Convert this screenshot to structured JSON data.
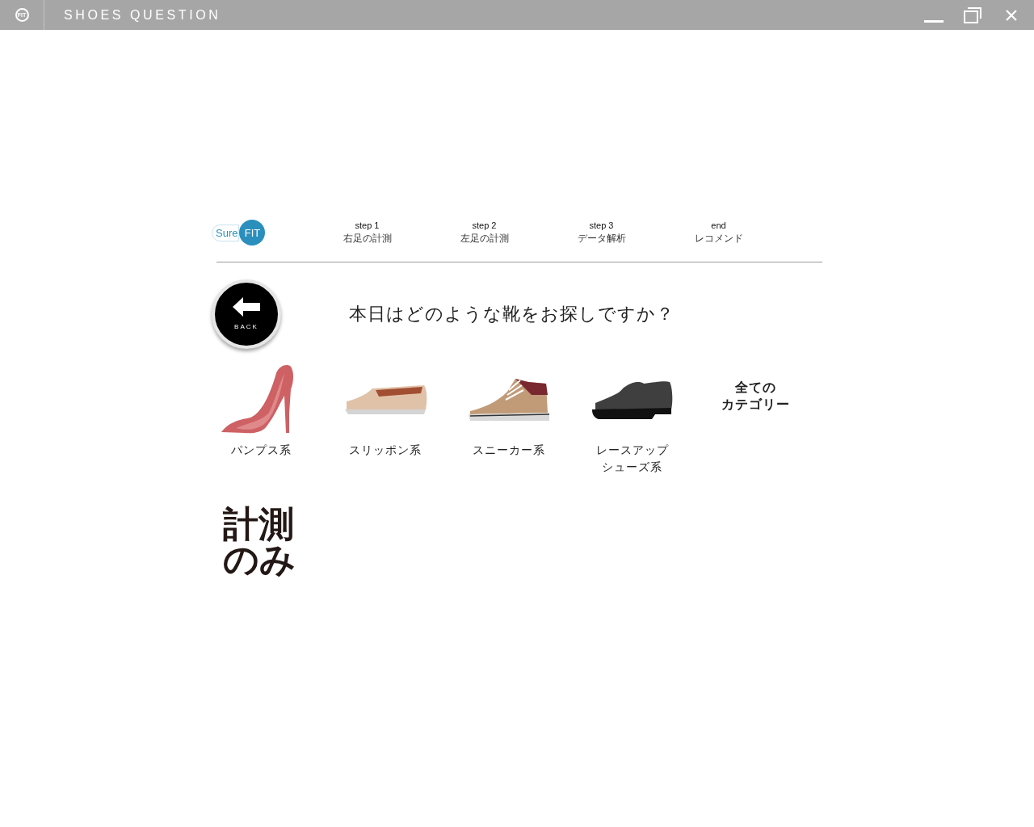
{
  "window": {
    "logo": "FIT",
    "title": "SHOES QUESTION"
  },
  "brand": {
    "part_1": "Sure",
    "part_2": "FIT"
  },
  "steps": [
    {
      "step": "step 1",
      "label": "右足の計測"
    },
    {
      "step": "step 2",
      "label": "左足の計測"
    },
    {
      "step": "step 3",
      "label": "データ解析"
    },
    {
      "step": "end",
      "label": "レコメンド"
    }
  ],
  "back_button": {
    "label": "BACK"
  },
  "question": "本日はどのような靴をお探しですか？",
  "options": [
    {
      "kind": "pumps",
      "label": "パンプス系"
    },
    {
      "kind": "slip-on",
      "label": "スリッポン系"
    },
    {
      "kind": "sneaker",
      "label": "スニーカー系"
    },
    {
      "kind": "lace-up",
      "label_lines": [
        "レースアップ",
        "シューズ系"
      ]
    },
    {
      "kind": "all",
      "label_lines": [
        "全ての",
        "カテゴリー"
      ]
    }
  ],
  "measure_only": [
    "計測",
    "のみ"
  ]
}
